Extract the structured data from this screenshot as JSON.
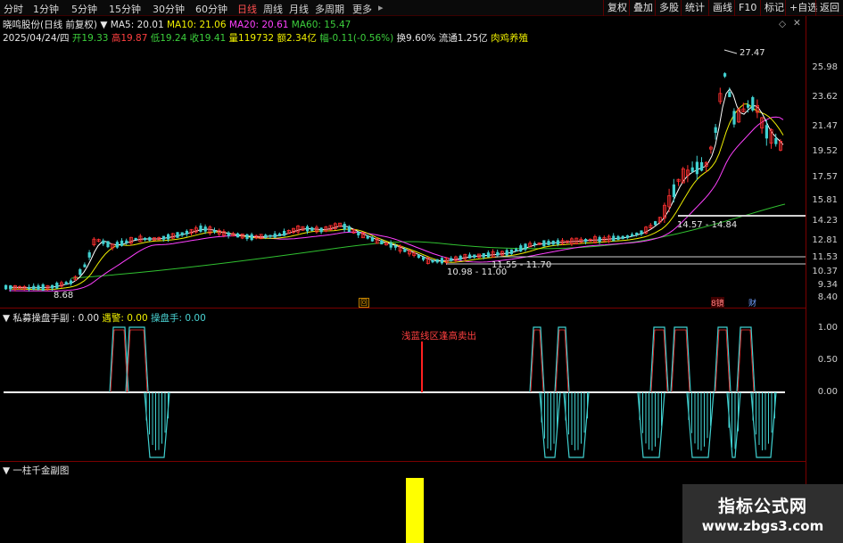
{
  "toolbar": {
    "periods": [
      "分时",
      "1分钟",
      "5分钟",
      "15分钟",
      "30分钟",
      "60分钟",
      "日线",
      "周线",
      "月线",
      "多周期",
      "更多"
    ],
    "active_period": "日线",
    "right_buttons": [
      "复权",
      "叠加",
      "多股",
      "统计",
      "画线",
      "F10",
      "标记",
      "+自选",
      "返回"
    ]
  },
  "header": {
    "stock_title": "晓鸣股份(日线 前复权)",
    "ma5": "MA5: 20.01",
    "ma10": "MA10: 21.06",
    "ma20": "MA20: 20.61",
    "ma60": "MA60: 15.47",
    "date": "2025/04/24/四",
    "open_label": "开",
    "open": "19.33",
    "high_label": "高",
    "high": "19.87",
    "low_label": "低",
    "low": "19.24",
    "close_label": "收",
    "close": "19.41",
    "volume_label": "量",
    "volume": "119732",
    "amount_label": "额",
    "amount": "2.34亿",
    "change_label": "幅",
    "change": "-0.11(-0.56%)",
    "turnover": "换9.60%",
    "float_cap": "流通1.25亿",
    "industry": "肉鸡养殖"
  },
  "price_axis": [
    "25.98",
    "23.62",
    "21.47",
    "19.52",
    "17.57",
    "15.81",
    "14.23",
    "12.81",
    "11.53",
    "10.37",
    "9.34",
    "8.40"
  ],
  "annotations": {
    "peak": "27.47",
    "low_mark": "8.68",
    "range1": "10.98 - 11.00",
    "range2": "11.55 - 11.70",
    "range3": "14.57 - 14.84",
    "event_box": "回",
    "badge_vol": "8镜",
    "badge_fin": "财"
  },
  "indicator1": {
    "name": "私募操盘手副",
    "value": ": 0.00",
    "alert_label": "遇警:",
    "alert_value": "0.00",
    "trader_label": "操盘手:",
    "trader_value": "0.00",
    "signal_text": "浅蓝线区逢高卖出",
    "axis": [
      "1.00",
      "0.50",
      "0.00"
    ]
  },
  "indicator2": {
    "name": "一柱千金副图"
  },
  "watermark": {
    "title": "指标公式网",
    "url": "www.zbgs3.com"
  },
  "colors": {
    "up": "#ff3030",
    "down": "#40d0d0",
    "ma5": "#ffffff",
    "ma10": "#f0f000",
    "ma20": "#ff40ff",
    "ma60": "#30c030",
    "bar": "#ffff00",
    "separator": "#7a0000"
  }
}
